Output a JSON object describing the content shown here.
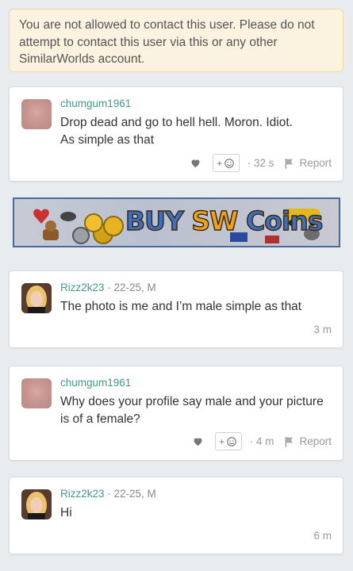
{
  "notice": {
    "text": "You are not allowed to contact this user. Please do not attempt to contact this user via this or any other SimilarWorlds account."
  },
  "banner": {
    "label_part1": "BUY ",
    "label_part2": "SW ",
    "label_part3": "Coins"
  },
  "comments": [
    {
      "username": "chumgum1961",
      "age_gender": "",
      "message": "Drop dead and go to hell hell. Moron. Idiot.\nAs simple as that",
      "time": "· 32 s",
      "report_label": "Report"
    },
    {
      "username": "Rizz2k23",
      "age_gender": " · 22-25, M",
      "message": "The photo is me and I’m male simple as that",
      "time": "3 m"
    },
    {
      "username": "chumgum1961",
      "age_gender": "",
      "message": "Why does your profile say male and your picture is of a female?",
      "time": "· 4 m",
      "report_label": "Report"
    },
    {
      "username": "Rizz2k23",
      "age_gender": " · 22-25, M",
      "message": "Hi",
      "time": "6 m"
    }
  ],
  "icons": {
    "like": "heart-icon",
    "react": "smiley-icon",
    "report": "flag-icon"
  },
  "colors": {
    "username": "#3f9c8c",
    "notice_bg": "#fcf2e0",
    "notice_border": "#f1d9a6"
  }
}
